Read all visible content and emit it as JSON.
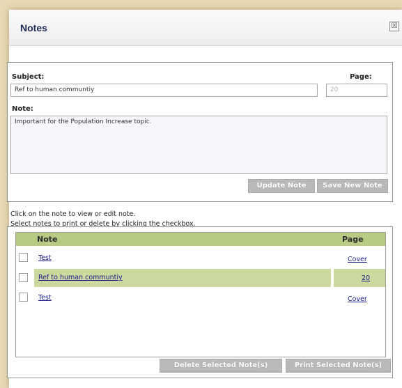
{
  "dialog": {
    "title": "Notes",
    "close_symbol": "☒"
  },
  "edit": {
    "subject_label": "Subject:",
    "subject_value": "Ref to human communtiy",
    "page_label": "Page:",
    "page_value": "20",
    "note_label": "Note:",
    "note_value": "Important for the Population Increase topic.",
    "update_button": "Update Note",
    "save_button": "Save New Note"
  },
  "instructions": {
    "line1": "Click on the note to view or edit note.",
    "line2": "Select notes to print or delete by clicking the checkbox."
  },
  "list": {
    "columns": {
      "note": "Note",
      "page": "Page"
    },
    "rows": [
      {
        "note": "Test",
        "page": "Cover",
        "selected": false
      },
      {
        "note": "Ref to human communtiy",
        "page": "20",
        "selected": true
      },
      {
        "note": "Test",
        "page": "Cover",
        "selected": false
      }
    ],
    "delete_button": "Delete Selected Note(s)",
    "print_button": "Print Selected Note(s)"
  },
  "colors": {
    "header_green": "#b8cb84",
    "selected_row": "#cbd99e",
    "button_gray": "#b9b9b9",
    "title_navy": "#1e2c5a"
  }
}
